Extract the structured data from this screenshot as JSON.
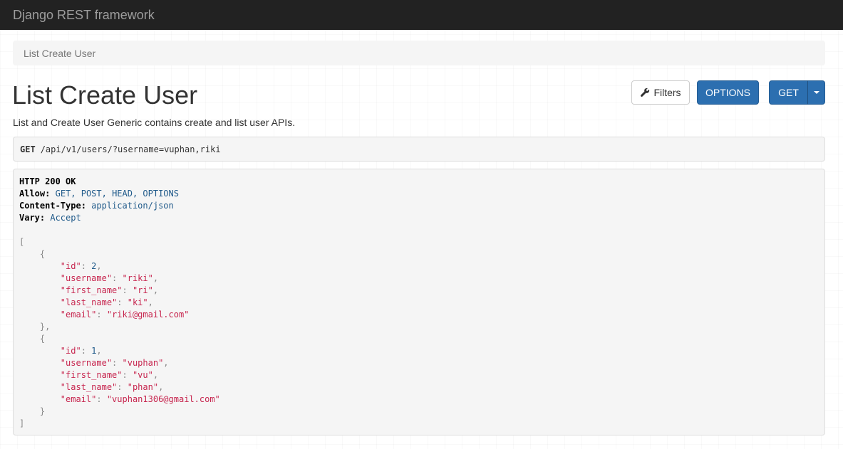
{
  "navbar": {
    "brand": "Django REST framework"
  },
  "breadcrumb": {
    "current": "List Create User"
  },
  "page": {
    "title": "List Create User",
    "description": "List and Create User Generic contains create and list user APIs."
  },
  "toolbar": {
    "filters_label": "Filters",
    "options_label": "OPTIONS",
    "get_label": "GET"
  },
  "request": {
    "method": "GET",
    "path": "/api/v1/users/?username=vuphan,riki"
  },
  "response": {
    "status": "HTTP 200 OK",
    "headers": [
      {
        "name": "Allow:",
        "value": "GET, POST, HEAD, OPTIONS"
      },
      {
        "name": "Content-Type:",
        "value": "application/json"
      },
      {
        "name": "Vary:",
        "value": "Accept"
      }
    ],
    "users": [
      {
        "id": "2",
        "username": "\"riki\"",
        "first_name": "\"ri\"",
        "last_name": "\"ki\"",
        "email": "\"riki@gmail.com\""
      },
      {
        "id": "1",
        "username": "\"vuphan\"",
        "first_name": "\"vu\"",
        "last_name": "\"phan\"",
        "email": "\"vuphan1306@gmail.com\""
      }
    ],
    "keys": {
      "id": "\"id\"",
      "username": "\"username\"",
      "first_name": "\"first_name\"",
      "last_name": "\"last_name\"",
      "email": "\"email\""
    }
  },
  "colors": {
    "navbar_bg": "#222222",
    "primary": "#2c6fb0",
    "string": "#c7254e",
    "number": "#205a8a"
  }
}
